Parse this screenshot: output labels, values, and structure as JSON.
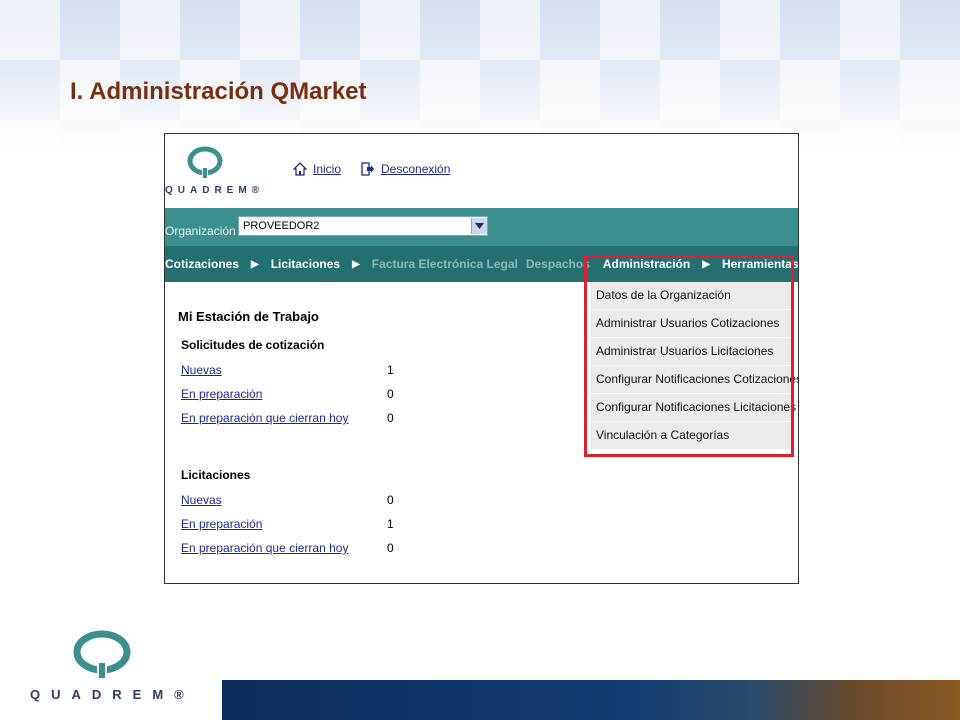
{
  "slide": {
    "title": "I.  Administración QMarket"
  },
  "app": {
    "logo_text": "QUADREM®",
    "top_links": {
      "inicio": "Inicio",
      "desconexion": "Desconexión"
    },
    "organization": {
      "label": "Organización",
      "value": "PROVEEDOR2"
    },
    "nav": {
      "cotizaciones": "Cotizaciones",
      "licitaciones": "Licitaciones",
      "factura": "Factura Electrónica Legal",
      "despachos": "Despachos",
      "administracion": "Administración",
      "herramientas": "Herramientas"
    },
    "admin_menu": [
      "Datos de la Organización",
      "Administrar Usuarios Cotizaciones",
      "Administrar Usuarios Licitaciones",
      "Configurar Notificaciones Cotizaciones",
      "Configurar Notificaciones Licitaciones",
      "Vinculación a Categorías"
    ],
    "workstation": {
      "title": "Mi Estación de Trabajo",
      "cotizacion": {
        "heading": "Solicitudes de cotización",
        "rows": [
          {
            "label": "Nuevas",
            "value": "1"
          },
          {
            "label": "En preparación",
            "value": "0"
          },
          {
            "label": "En preparación que cierran hoy",
            "value": "0"
          }
        ]
      },
      "licitaciones": {
        "heading": "Licitaciones",
        "rows": [
          {
            "label": "Nuevas",
            "value": "0"
          },
          {
            "label": "En preparación",
            "value": "1"
          },
          {
            "label": "En preparación que cierran hoy",
            "value": "0"
          }
        ]
      }
    }
  },
  "footer": {
    "logo_text": "QUADREM®"
  },
  "colors": {
    "title": "#7a2e10",
    "org_bar": "#3b8f8f",
    "nav_bar": "#246f70",
    "highlight": "#e0202a",
    "link": "#1c2a8f"
  }
}
